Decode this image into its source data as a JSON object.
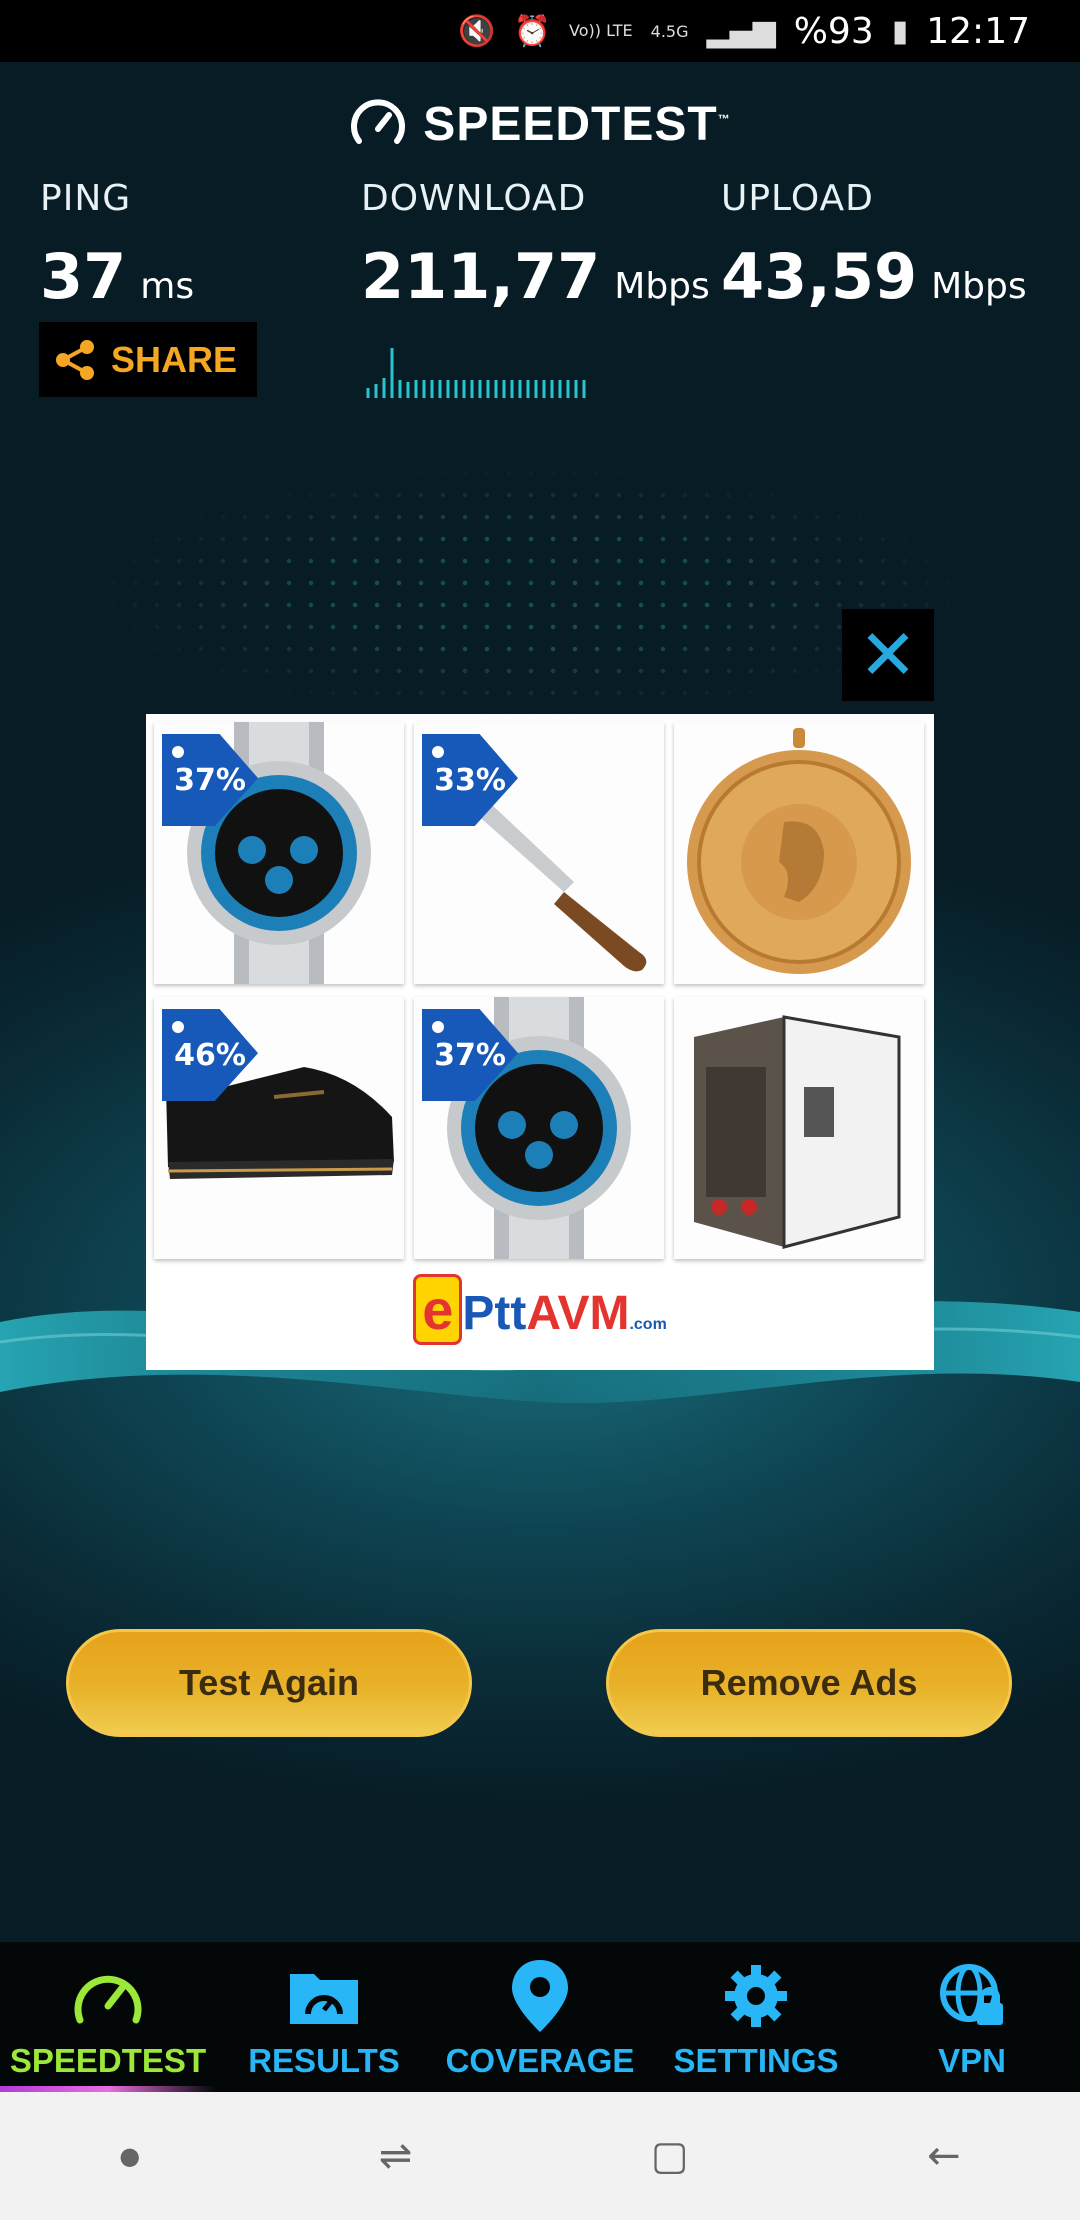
{
  "status_bar": {
    "battery": "%93",
    "time": "12:17",
    "network": "4.5G",
    "volte": "Vo)) LTE"
  },
  "app": {
    "title": "SPEEDTEST",
    "tm": "™"
  },
  "metrics": {
    "ping": {
      "label": "PING",
      "value": "37",
      "unit": "ms"
    },
    "download": {
      "label": "DOWNLOAD",
      "value": "211,77",
      "unit": "Mbps"
    },
    "upload": {
      "label": "UPLOAD",
      "value": "43,59",
      "unit": "Mbps"
    }
  },
  "share_label": "SHARE",
  "ad": {
    "close_glyph": "✕",
    "tiles": [
      {
        "discount": "37%",
        "product": "watch"
      },
      {
        "discount": "33%",
        "product": "knife"
      },
      {
        "discount": "",
        "product": "gold-coin"
      },
      {
        "discount": "46%",
        "product": "sneaker"
      },
      {
        "discount": "37%",
        "product": "watch"
      },
      {
        "discount": "",
        "product": "welding-machine"
      }
    ],
    "brand": {
      "e": "e",
      "ptt": "Ptt",
      "avm": "AVM",
      "com": ".com"
    }
  },
  "buttons": {
    "test_again": "Test Again",
    "remove_ads": "Remove Ads"
  },
  "tabs": [
    {
      "label": "SPEEDTEST",
      "icon": "speedometer-icon",
      "active": true
    },
    {
      "label": "RESULTS",
      "icon": "results-folder-icon",
      "active": false
    },
    {
      "label": "COVERAGE",
      "icon": "map-pin-icon",
      "active": false
    },
    {
      "label": "SETTINGS",
      "icon": "gear-icon",
      "active": false
    },
    {
      "label": "VPN",
      "icon": "globe-lock-icon",
      "active": false
    }
  ],
  "colors": {
    "accent_gold": "#e8b22a",
    "tab_blue": "#29b6f6",
    "tab_active": "#9be83a",
    "share_orange": "#f5a623",
    "badge_blue": "#1659b8"
  }
}
